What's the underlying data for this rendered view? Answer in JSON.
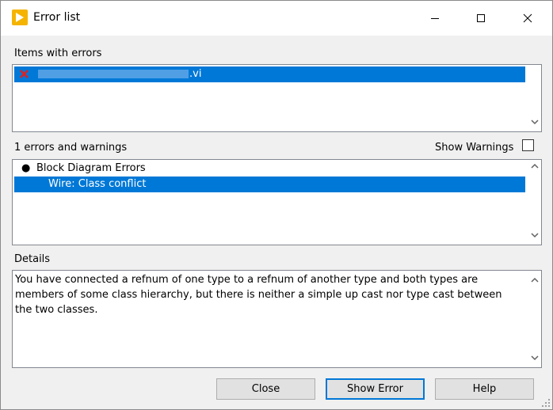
{
  "window": {
    "title": "Error list",
    "icon": "labview-run-arrow-icon"
  },
  "title_controls": [
    "minimize-icon",
    "maximize-icon",
    "close-icon"
  ],
  "items_section": {
    "label": "Items with errors",
    "items": [
      {
        "icon": "error-x-icon",
        "name_suffix": ".vi",
        "name_obscured": true
      }
    ]
  },
  "errors_section": {
    "count_label": "1 errors and warnings",
    "show_warnings_label": "Show Warnings",
    "show_warnings_checked": false,
    "tree": [
      {
        "bullet": "●",
        "label": "Block Diagram Errors"
      },
      {
        "label": "Wire: Class conflict",
        "selected": true
      }
    ]
  },
  "details": {
    "label": "Details",
    "text": "You have connected a refnum of one type to a refnum of another type and both types are members of some class hierarchy, but there is neither a simple up cast nor type cast between the two classes."
  },
  "buttons": {
    "close": "Close",
    "show_error": "Show Error",
    "help": "Help"
  },
  "colors": {
    "selection": "#0078d7",
    "dialog_bg": "#f0f0f0",
    "error_x": "#d0021b",
    "icon_yellow": "#f5b400"
  }
}
